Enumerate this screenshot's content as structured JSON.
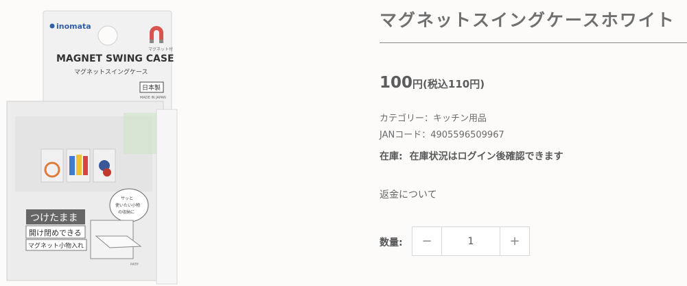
{
  "product": {
    "title": "マグネットスイングケースホワイト",
    "price_main": "100",
    "price_unit": "円",
    "price_tax": "(税込110円)",
    "category": "カテゴリー：キッチン用品",
    "jan": "JANコード：4905596509967",
    "stock_label": "在庫:",
    "stock_value": "在庫状況はログイン後確認できます",
    "refund_link": "返金について",
    "quantity_label": "数量:",
    "quantity_value": "1",
    "minus": "−",
    "plus": "+"
  },
  "image": {
    "brand": "inomata",
    "name_en": "MAGNET SWING CASE",
    "name_ja": "マグネットスイングケース",
    "made_in": "日本製",
    "made_in_en": "MADE IN JAPAN",
    "magnet_note": "マグネット付",
    "promo_line1": "つけたまま",
    "promo_line2": "開け閉めできる",
    "promo_line3": "マグネット小物入れ",
    "bubble_line1": "サッと",
    "bubble_line2": "使いたい小物",
    "bubble_line3": "の収納に",
    "code": "PATP"
  }
}
